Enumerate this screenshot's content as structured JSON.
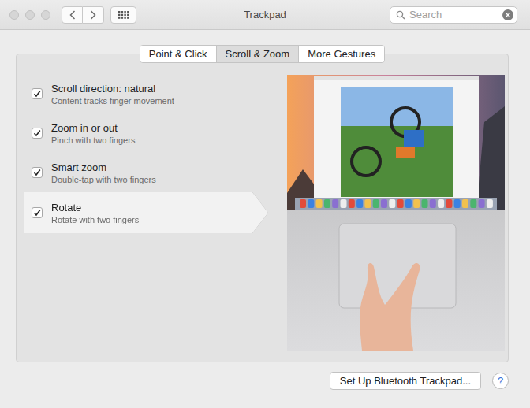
{
  "window": {
    "title": "Trackpad"
  },
  "search": {
    "placeholder": "Search"
  },
  "tabs": [
    {
      "label": "Point & Click",
      "selected": false
    },
    {
      "label": "Scroll & Zoom",
      "selected": true
    },
    {
      "label": "More Gestures",
      "selected": false
    }
  ],
  "options": [
    {
      "title": "Scroll direction: natural",
      "subtitle": "Content tracks finger movement",
      "checked": true,
      "selected": false
    },
    {
      "title": "Zoom in or out",
      "subtitle": "Pinch with two fingers",
      "checked": true,
      "selected": false
    },
    {
      "title": "Smart zoom",
      "subtitle": "Double-tap with two fingers",
      "checked": true,
      "selected": false
    },
    {
      "title": "Rotate",
      "subtitle": "Rotate with two fingers",
      "checked": true,
      "selected": true
    }
  ],
  "buttons": [
    {
      "label": "Set Up Bluetooth Trackpad..."
    }
  ],
  "help": {
    "label": "?"
  }
}
